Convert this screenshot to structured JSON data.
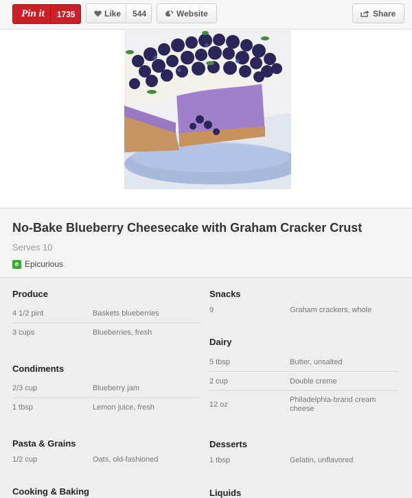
{
  "toolbar": {
    "pin_label": "Pin it",
    "pin_count": "1735",
    "like_label": "Like",
    "like_count": "544",
    "website_label": "Website",
    "share_label": "Share"
  },
  "recipe": {
    "title": "No-Bake Blueberry Cheesecake with Graham Cracker Crust",
    "serves": "Serves 10",
    "source": "Epicurious"
  },
  "categories": {
    "produce": "Produce",
    "condiments": "Condiments",
    "pasta_grains": "Pasta & Grains",
    "cooking_baking": "Cooking & Baking",
    "snacks": "Snacks",
    "dairy": "Dairy",
    "desserts": "Desserts",
    "liquids": "Liquids"
  },
  "produce": [
    {
      "qty": "4 1/2 pint",
      "name": "Baskets blueberries"
    },
    {
      "qty": "3 cups",
      "name": "Blueberries, fresh"
    }
  ],
  "condiments": [
    {
      "qty": "2/3 cup",
      "name": "Blueberry jam"
    },
    {
      "qty": "1 tbsp",
      "name": "Lemon juice, fresh"
    }
  ],
  "pasta_grains": [
    {
      "qty": "1/2 cup",
      "name": "Oats, old-fashioned"
    }
  ],
  "snacks": [
    {
      "qty": "9",
      "name": "Graham crackers, whole"
    }
  ],
  "dairy": [
    {
      "qty": "5 tbsp",
      "name": "Butter, unsalted"
    },
    {
      "qty": "2 cup",
      "name": "Double creme"
    },
    {
      "qty": "12 oz",
      "name": "Philadelphia-brand cream cheese"
    }
  ],
  "desserts": [
    {
      "qty": "1 tbsp",
      "name": "Gelatin, unflavored"
    }
  ],
  "colors": {
    "pinterest_red": "#cb2027",
    "source_green": "#3aaa35"
  },
  "icons": [
    "heart-icon",
    "globe-icon",
    "share-icon",
    "epicurious-icon"
  ]
}
